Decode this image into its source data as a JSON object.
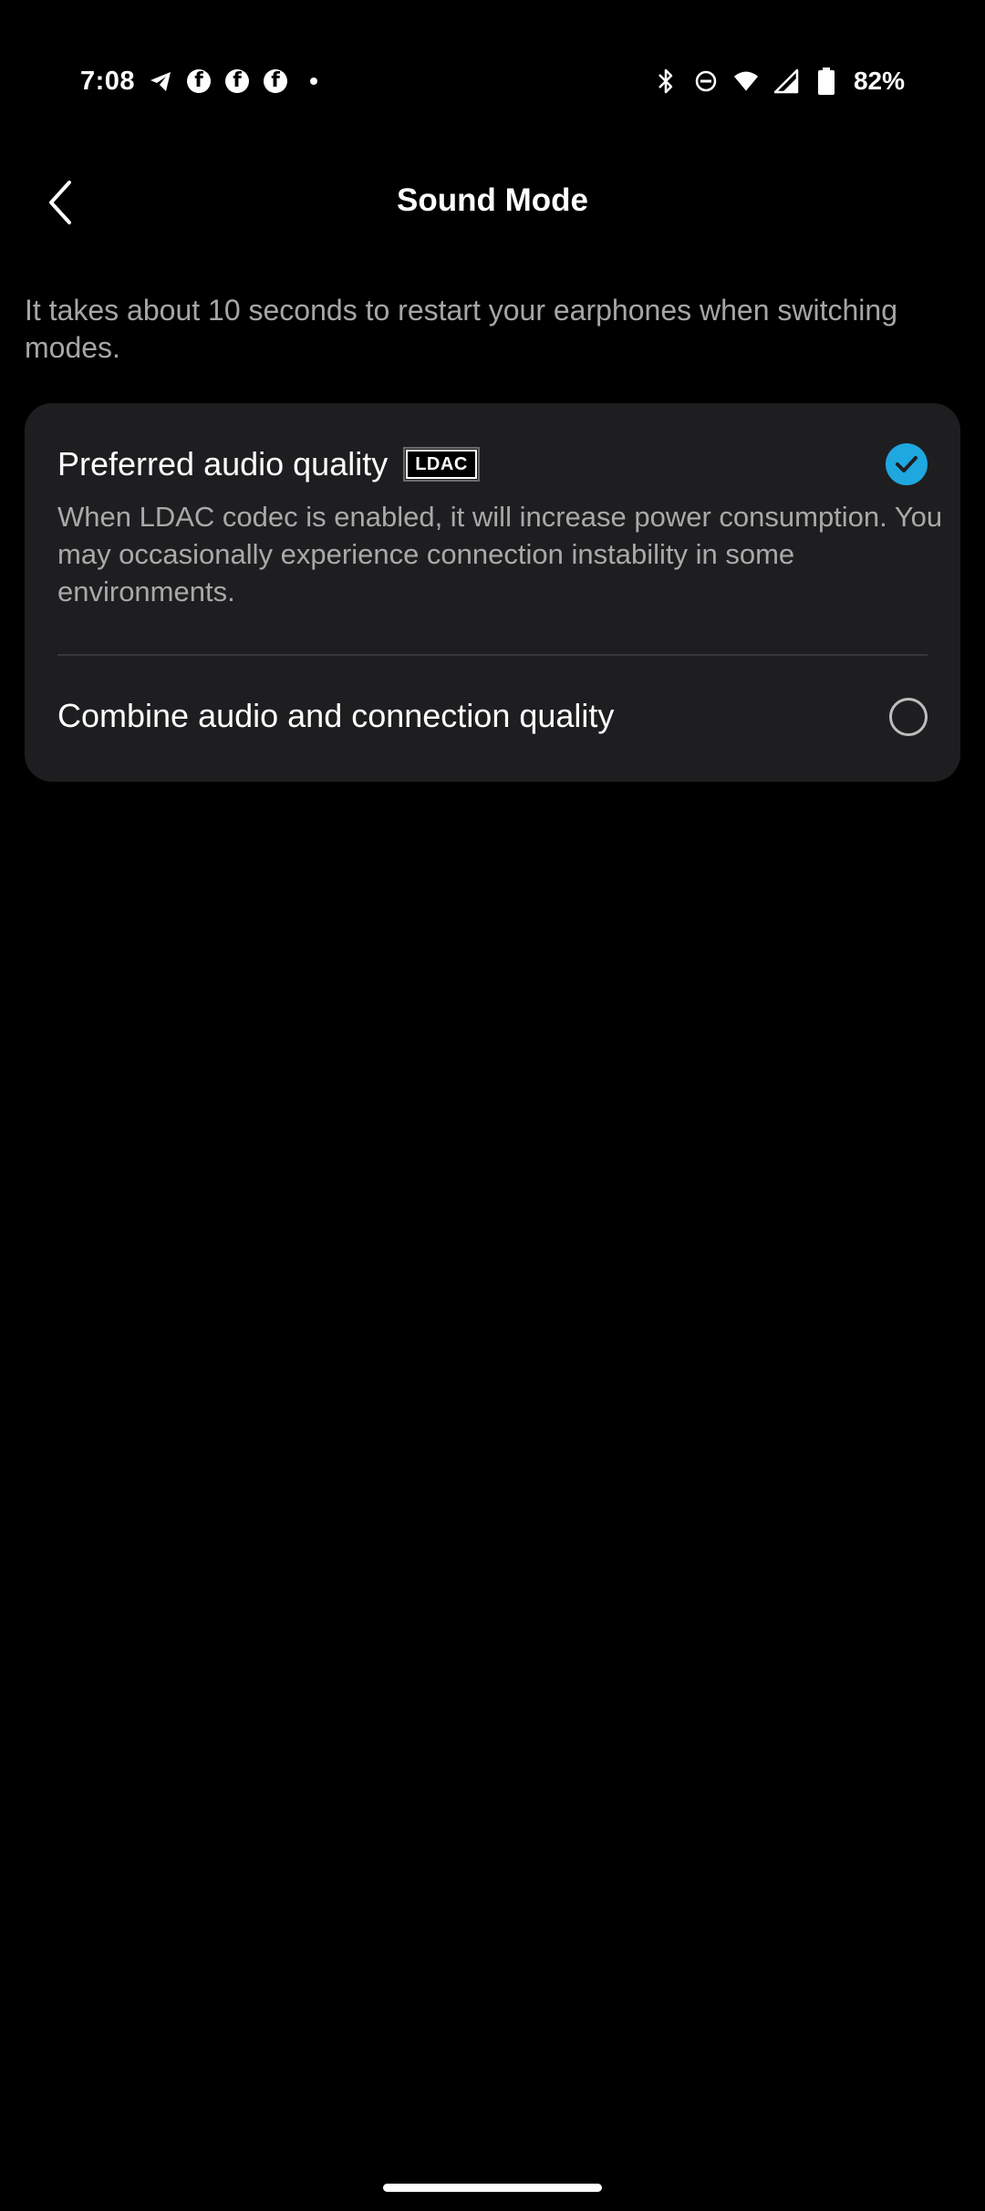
{
  "status_bar": {
    "time": "7:08",
    "battery_percent": "82%",
    "notification_icons": [
      "telegram-icon",
      "facebook-icon",
      "facebook-icon",
      "facebook-icon",
      "dot-icon"
    ],
    "system_icons": [
      "bluetooth-icon",
      "do-not-disturb-icon",
      "wifi-icon",
      "cellular-icon",
      "battery-icon"
    ]
  },
  "header": {
    "title": "Sound Mode",
    "back_icon": "chevron-left-icon"
  },
  "info": {
    "text": "It takes about 10 seconds to restart your earphones when switching modes."
  },
  "options": [
    {
      "title": "Preferred audio quality",
      "badge": "LDAC",
      "description": "When LDAC codec is enabled, it will increase power consumption. You may occasionally experience connection instability in some environments.",
      "selected": true
    },
    {
      "title": "Combine audio and connection quality",
      "selected": false
    }
  ],
  "colors": {
    "background": "#000000",
    "card": "#1e1e20",
    "accent": "#1fa7e0",
    "secondary_text": "#a6a6a6"
  }
}
